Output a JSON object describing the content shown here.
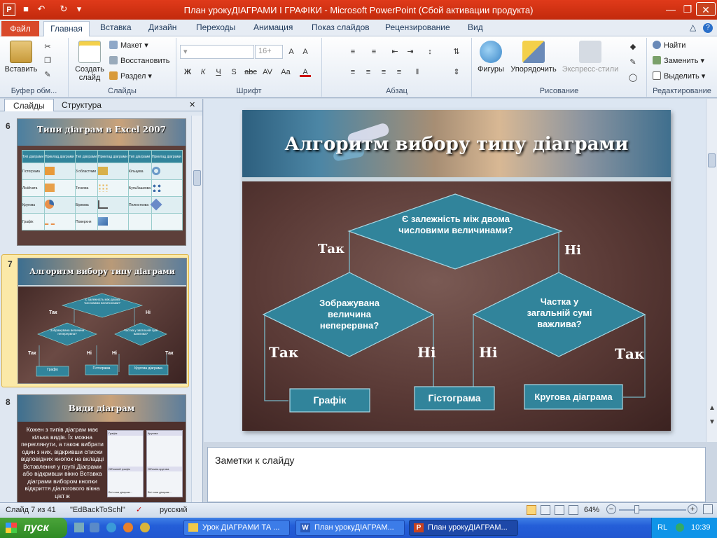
{
  "window": {
    "title": "План урокуДІАГРАМИ І ГРАФІКИ  -  Microsoft PowerPoint (Сбой активации продукта)"
  },
  "ribbon_tabs": [
    "Файл",
    "Главная",
    "Вставка",
    "Дизайн",
    "Переходы",
    "Анимация",
    "Показ слайдов",
    "Рецензирование",
    "Вид"
  ],
  "ribbon": {
    "clipboard": {
      "paste": "Вставить",
      "label": "Буфер обм..."
    },
    "slides": {
      "create": "Создать слайд",
      "layout": "Макет",
      "reset": "Восстановить",
      "section": "Раздел",
      "label": "Слайды"
    },
    "font": {
      "size": "16+",
      "label": "Шрифт",
      "b": "Ж",
      "i": "К",
      "u": "Ч",
      "s": "S",
      "abc": "abc",
      "av": "AV",
      "aa": "Aa",
      "a": "A"
    },
    "paragraph": {
      "label": "Абзац"
    },
    "drawing": {
      "shapes": "Фигуры",
      "arrange": "Упорядочить",
      "styles": "Экспресс-стили",
      "label": "Рисование"
    },
    "editing": {
      "find": "Найти",
      "replace": "Заменить",
      "select": "Выделить",
      "label": "Редактирование"
    }
  },
  "pane_tabs": [
    "Слайды",
    "Структура"
  ],
  "thumbs": [
    {
      "num": "6",
      "title": "Типи діаграм в Excel 2007",
      "headers": [
        "Тип діаграми",
        "Приклад діаграми",
        "Тип діаграми",
        "Приклад діаграми",
        "Тип діаграми",
        "Приклад діаграми"
      ],
      "rows": [
        [
          "Гістограма",
          "3 областями",
          "Кільцева"
        ],
        [
          "Лінійчата",
          "Точкова",
          "Бульбашкова"
        ],
        [
          "Кругова",
          "Біржова",
          "Пелюсткова"
        ],
        [
          "Графік",
          "Поверхня",
          ""
        ]
      ]
    },
    {
      "num": "7",
      "title": "Алгоритм вибору типу діаграми",
      "q1": "Є залежність між двома числовими величинами?",
      "q2": "Зображувана величина неперервна?",
      "q3": "Частка у загальній сумі важлива?",
      "yes": "Так",
      "no": "Ні",
      "r1": "Графік",
      "r2": "Гістограма",
      "r3": "Кругова діаграма"
    },
    {
      "num": "8",
      "title": "Види діаграм",
      "body": "Кожен з типів діаграм має кілька видів. Їх можна переглянути, а також вибрати один з них, відкривши списки відповідних кнопок на вкладці Вставлення у групі Діаграми або відкривши вікно Вставка діаграми вибором кнопки відкриття діалогового вікна цієї ж",
      "panel_a": "Графік",
      "panel_b": "Кругова",
      "panel_c": "Об'ємний графік",
      "panel_d": "Об'ємна кругова",
      "panel_e": "Всі типи діаграм..."
    }
  ],
  "slide": {
    "title": "Алгоритм вибору типу діаграми",
    "q1": "Є залежність  між двома числовими величинами?",
    "q2": "Зображувана величина неперервна?",
    "q3": "Частка у загальній сумі важлива?",
    "yes": "Так",
    "no": "Ні",
    "r1": "Графік",
    "r2": "Гістограма",
    "r3": "Кругова діаграма",
    "colors": {
      "diamond": "#31849b",
      "box": "#31849b",
      "line": "#7ab8c8",
      "bg": "#5a3a36"
    }
  },
  "notes": {
    "placeholder": "Заметки к слайду"
  },
  "status": {
    "slide": "Слайд 7 из 41",
    "theme": "\"EdBackToSchl\"",
    "lang": "русский",
    "zoom": "64%"
  },
  "taskbar": {
    "start": "пуск",
    "tasks": [
      "Урок ДІАГРАМИ ТА ...",
      "План урокуДІАГРАМ...",
      "План урокуДІАГРАМ..."
    ],
    "lang": "RL",
    "clock": "10:39"
  }
}
